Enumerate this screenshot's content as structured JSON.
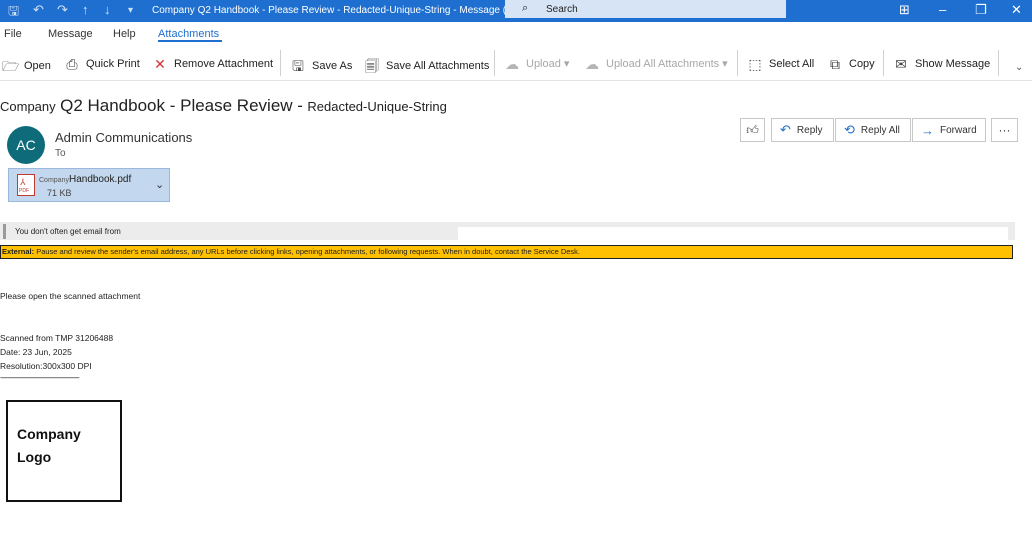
{
  "window": {
    "title": "Company Q2 Handbook - Please Review - Redacted-Unique-String - Message (HT...",
    "search_placeholder": "Search",
    "icons": [
      "save-icon",
      "undo-icon",
      "redo-icon",
      "up-arrow-icon",
      "down-arrow-icon",
      "customize-icon"
    ]
  },
  "menu": {
    "file": "File",
    "message": "Message",
    "help": "Help",
    "attachments": "Attachments"
  },
  "ribbon": {
    "open": "Open",
    "quick_print": "Quick Print",
    "remove_attachment": "Remove Attachment",
    "save_as": "Save As",
    "save_all": "Save All Attachments",
    "upload": "Upload",
    "upload_all": "Upload All Attachments",
    "select_all": "Select All",
    "copy": "Copy",
    "show_message": "Show Message"
  },
  "email": {
    "subject_prefix": "Company",
    "subject_main": "Q2 Handbook - Please Review -",
    "subject_suffix": "Redacted-Unique-String",
    "avatar_initials": "AC",
    "sender": "Admin Communications",
    "to_label": "To",
    "actions": {
      "reply": "Reply",
      "reply_all": "Reply All",
      "forward": "Forward",
      "more": "···"
    },
    "attachment": {
      "name_prefix": "Company",
      "name": "Handbook.pdf",
      "size": "71 KB",
      "icon_label": "PDF"
    },
    "warning_banner": "You don't often get email from",
    "external_label": "External:",
    "external_text": "Pause and review the sender's email address, any URLs before clicking links, opening attachments, or following requests. When in doubt, contact the Service Desk.",
    "body": {
      "line1": "Please open the scanned attachment",
      "scanned_from": "Scanned from TMP 31206488",
      "date": "Date: 23 Jun, 2025",
      "resolution": "Resolution:300x300 DPI",
      "divider": "-------------------------------------------"
    },
    "logo_line1": "Company",
    "logo_line2": "Logo"
  },
  "colors": {
    "titlebar": "#1f6fd0",
    "accent": "#1f6fd0",
    "external_banner": "#ffc000",
    "avatar": "#0e6c7a"
  }
}
